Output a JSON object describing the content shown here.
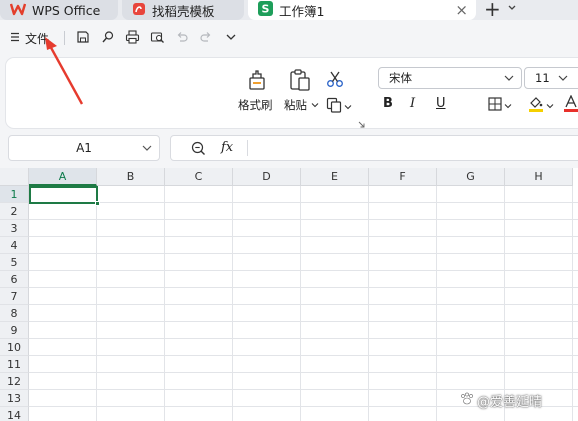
{
  "tabs": [
    {
      "label": "WPS Office",
      "icon": "wps-logo-icon",
      "state": "inactive"
    },
    {
      "label": "找稻壳模板",
      "icon": "docer-logo-icon",
      "state": "inactive"
    },
    {
      "label": "工作簿1",
      "icon": "spreadsheet-s-icon",
      "state": "active"
    }
  ],
  "quick_toolbar": {
    "menu_label": "文件"
  },
  "ribbon": {
    "format_painter_label": "格式刷",
    "paste_label": "粘贴",
    "font_name": "宋体",
    "font_size": "11",
    "bold": "B",
    "italic": "I",
    "underline": "U"
  },
  "formula_bar": {
    "name_box": "A1",
    "fx": "fx"
  },
  "sheet": {
    "columns": [
      "A",
      "B",
      "C",
      "D",
      "E",
      "F",
      "G",
      "H"
    ],
    "rows": [
      "1",
      "2",
      "3",
      "4",
      "5",
      "6",
      "7",
      "8",
      "9",
      "10",
      "11",
      "12",
      "13",
      "14"
    ],
    "selected_cell": "A1"
  },
  "watermark": "@爱善延晴",
  "colors": {
    "accent_green": "#1e7a45",
    "annotation_red": "#e63b2e",
    "wps_red": "#e33e2b"
  }
}
